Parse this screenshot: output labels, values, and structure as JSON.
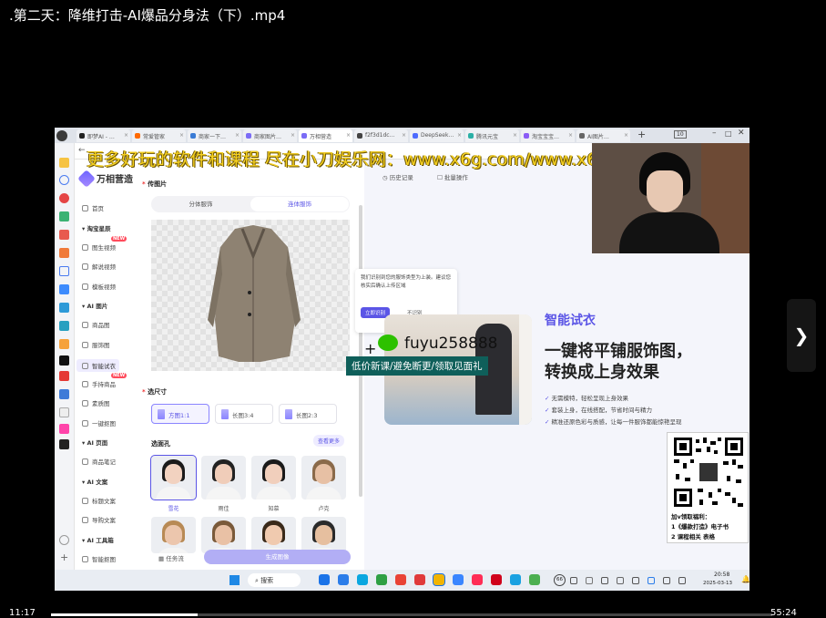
{
  "video": {
    "title": ".第二天：降维打击-AI爆品分身法（下）.mp4",
    "current_time": "11:17",
    "total_time": "55:24",
    "progress": 0.203
  },
  "browser": {
    "tabs": [
      "即梦AI - …",
      "常爱管家",
      "商家一下…",
      "商家图片…",
      "万相营造",
      "f2f3d1dc…",
      "DeepSeek…",
      "腾讯元宝",
      "淘宝宝宝…",
      "AI图片…"
    ],
    "tab_count": "10"
  },
  "watermark": {
    "text": "更多好玩的软件和课程 尽在小刀娱乐网：www.x6g.com/www.x6d.com"
  },
  "promo": {
    "wechat_id": "fuyu258888",
    "banner": "低价新课/避免断更/领取见面礼",
    "qr_caption_1": "加v领取福利：",
    "qr_caption_2": "1《爆款打造》电子书",
    "qr_caption_3": "2 课程相关 表格"
  },
  "app": {
    "name": "万相营造",
    "nav": [
      {
        "type": "item",
        "label": "首页"
      },
      {
        "type": "section",
        "label": "淘宝星辰"
      },
      {
        "type": "item",
        "label": "图生视频",
        "new": true
      },
      {
        "type": "item",
        "label": "解说视频"
      },
      {
        "type": "item",
        "label": "模板视频"
      },
      {
        "type": "section",
        "label": "AI 图片"
      },
      {
        "type": "item",
        "label": "商品图"
      },
      {
        "type": "item",
        "label": "服饰图"
      },
      {
        "type": "item",
        "label": "智能试衣",
        "active": true
      },
      {
        "type": "item",
        "label": "手持商品",
        "new": true
      },
      {
        "type": "item",
        "label": "素质图"
      },
      {
        "type": "item",
        "label": "一键抠图"
      },
      {
        "type": "section",
        "label": "AI 页面"
      },
      {
        "type": "item",
        "label": "商品笔记"
      },
      {
        "type": "section",
        "label": "AI 文案"
      },
      {
        "type": "item",
        "label": "标题文案"
      },
      {
        "type": "item",
        "label": "导购文案"
      },
      {
        "type": "section",
        "label": "AI 工具箱"
      },
      {
        "type": "item",
        "label": "智能抠图"
      }
    ],
    "new_badge": "NEW",
    "upload_label": "传图片",
    "mode_tabs": [
      "分体服饰",
      "连体服饰"
    ],
    "size_label": "选尺寸",
    "sizes": [
      "方图1:1",
      "长图3:4",
      "长图2:3"
    ],
    "model_label": "选面孔",
    "see_more": "查看更多",
    "models": [
      "雪花",
      "雨佳",
      "知慕",
      "卢克",
      "",
      "",
      "",
      ""
    ],
    "task_flow": "任务流",
    "generate": "生成图像",
    "history": "历史记录",
    "batch": "批量操作",
    "tooltip": "我们识别到您的服饰类型为上装。建议您核实后确认上传区域",
    "tooltip_ok": "立即识别",
    "tooltip_no": "不识别",
    "feature_title": "智能试衣",
    "feature_headline_1": "一键将平铺服饰图，",
    "feature_headline_2": "转换成上身效果",
    "feature_points": [
      "无需模特，轻松呈现上身效果",
      "套装上身，在线搭配，节省时间与精力",
      "精准还原色彩与质感，让每一件服饰都能惊艳呈现"
    ]
  },
  "taskbar": {
    "search": "搜索",
    "time": "20:58",
    "date": "2025-03-13",
    "badge": "66"
  }
}
